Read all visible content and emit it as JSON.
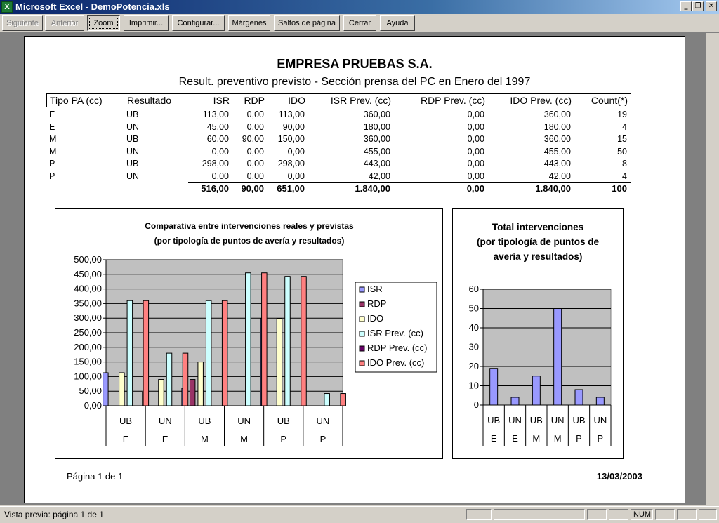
{
  "window": {
    "title": "Microsoft Excel - DemoPotencia.xls",
    "app_icon": "excel-icon"
  },
  "toolbar": {
    "buttons": [
      {
        "label": "Siguiente",
        "state": "disabled"
      },
      {
        "label": "Anterior",
        "state": "disabled"
      },
      {
        "label": "Zoom",
        "state": "pressed"
      },
      {
        "label": "Imprimir...",
        "state": "normal"
      },
      {
        "label": "Configurar...",
        "state": "normal"
      },
      {
        "label": "Márgenes",
        "state": "normal"
      },
      {
        "label": "Saltos de página",
        "state": "normal"
      },
      {
        "label": "Cerrar",
        "state": "normal"
      },
      {
        "label": "Ayuda",
        "state": "normal"
      }
    ]
  },
  "report": {
    "company": "EMPRESA PRUEBAS S.A.",
    "subtitle": "Result. preventivo previsto - Sección prensa del PC en Enero del 1997",
    "columns": [
      "Tipo PA (cc)",
      "Resultado",
      "ISR",
      "RDP",
      "IDO",
      "ISR Prev. (cc)",
      "RDP Prev. (cc)",
      "IDO Prev. (cc)",
      "Count(*)"
    ],
    "rows": [
      [
        "E",
        "UB",
        "113,00",
        "0,00",
        "113,00",
        "360,00",
        "0,00",
        "360,00",
        "19"
      ],
      [
        "E",
        "UN",
        "45,00",
        "0,00",
        "90,00",
        "180,00",
        "0,00",
        "180,00",
        "4"
      ],
      [
        "M",
        "UB",
        "60,00",
        "90,00",
        "150,00",
        "360,00",
        "0,00",
        "360,00",
        "15"
      ],
      [
        "M",
        "UN",
        "0,00",
        "0,00",
        "0,00",
        "455,00",
        "0,00",
        "455,00",
        "50"
      ],
      [
        "P",
        "UB",
        "298,00",
        "0,00",
        "298,00",
        "443,00",
        "0,00",
        "443,00",
        "8"
      ],
      [
        "P",
        "UN",
        "0,00",
        "0,00",
        "0,00",
        "42,00",
        "0,00",
        "42,00",
        "4"
      ]
    ],
    "totals": [
      "",
      "",
      "516,00",
      "90,00",
      "651,00",
      "1.840,00",
      "0,00",
      "1.840,00",
      "100"
    ],
    "footer_page": "Página 1 de 1",
    "footer_date": "13/03/2003"
  },
  "chart_data": [
    {
      "type": "bar",
      "title_line1": "Comparativa entre intervenciones reales y previstas",
      "title_line2": "(por tipología de puntos de avería y resultados)",
      "categories": [
        [
          "UB",
          "E"
        ],
        [
          "UN",
          "E"
        ],
        [
          "UB",
          "M"
        ],
        [
          "UN",
          "M"
        ],
        [
          "UB",
          "P"
        ],
        [
          "UN",
          "P"
        ]
      ],
      "ylim": [
        0,
        500
      ],
      "yticks": [
        "0,00",
        "50,00",
        "100,00",
        "150,00",
        "200,00",
        "250,00",
        "300,00",
        "350,00",
        "400,00",
        "450,00",
        "500,00"
      ],
      "series": [
        {
          "name": "ISR",
          "color": "#9999ff",
          "values": [
            113,
            45,
            60,
            0,
            298,
            0
          ]
        },
        {
          "name": "RDP",
          "color": "#993366",
          "values": [
            0,
            0,
            90,
            0,
            0,
            0
          ]
        },
        {
          "name": "IDO",
          "color": "#ffffcc",
          "values": [
            113,
            90,
            150,
            0,
            298,
            0
          ]
        },
        {
          "name": "ISR Prev. (cc)",
          "color": "#ccffff",
          "values": [
            360,
            180,
            360,
            455,
            443,
            42
          ]
        },
        {
          "name": "RDP Prev. (cc)",
          "color": "#660066",
          "values": [
            0,
            0,
            0,
            0,
            0,
            0
          ]
        },
        {
          "name": "IDO Prev. (cc)",
          "color": "#ff8080",
          "values": [
            360,
            180,
            360,
            455,
            443,
            42
          ]
        }
      ],
      "plot_bg": "#c0c0c0",
      "grid": true,
      "legend": "right"
    },
    {
      "type": "bar",
      "title_line1": "Total intervenciones",
      "title_line2": "(por tipología de puntos de",
      "title_line3": "avería y resultados)",
      "categories": [
        [
          "UB",
          "E"
        ],
        [
          "UN",
          "E"
        ],
        [
          "UB",
          "M"
        ],
        [
          "UN",
          "M"
        ],
        [
          "UB",
          "P"
        ],
        [
          "UN",
          "P"
        ]
      ],
      "ylim": [
        0,
        60
      ],
      "yticks": [
        "0",
        "10",
        "20",
        "30",
        "40",
        "50",
        "60"
      ],
      "series": [
        {
          "color": "#9999ff",
          "values": [
            19,
            4,
            15,
            50,
            8,
            4
          ]
        }
      ],
      "plot_bg": "#c0c0c0",
      "grid": true
    }
  ],
  "statusbar": {
    "text": "Vista previa: página 1 de 1",
    "num": "NUM"
  }
}
